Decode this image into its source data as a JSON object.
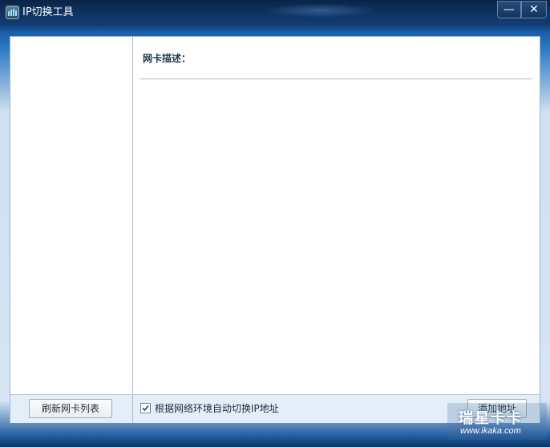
{
  "window": {
    "title": "IP切换工具",
    "minimize_glyph": "—",
    "close_glyph": "✕"
  },
  "detail": {
    "nic_description_label": "网卡描述："
  },
  "bottom": {
    "refresh_button": "刷新网卡列表",
    "auto_switch_label": "根据网络环境自动切换IP地址",
    "auto_switch_checked": true,
    "add_address_button": "添加地址"
  },
  "watermark": {
    "main": "瑞星卡卡",
    "sub": "www.ikaka.com"
  },
  "icons": {
    "app": "network-adapter-icon",
    "minimize": "minimize-icon",
    "close": "close-icon",
    "checkbox": "checkmark-icon"
  },
  "colors": {
    "titlebar": "#0f3464",
    "frame": "#2b78c4",
    "panel_border": "#a9bccd",
    "bottom_bar": "#e4eef8"
  }
}
